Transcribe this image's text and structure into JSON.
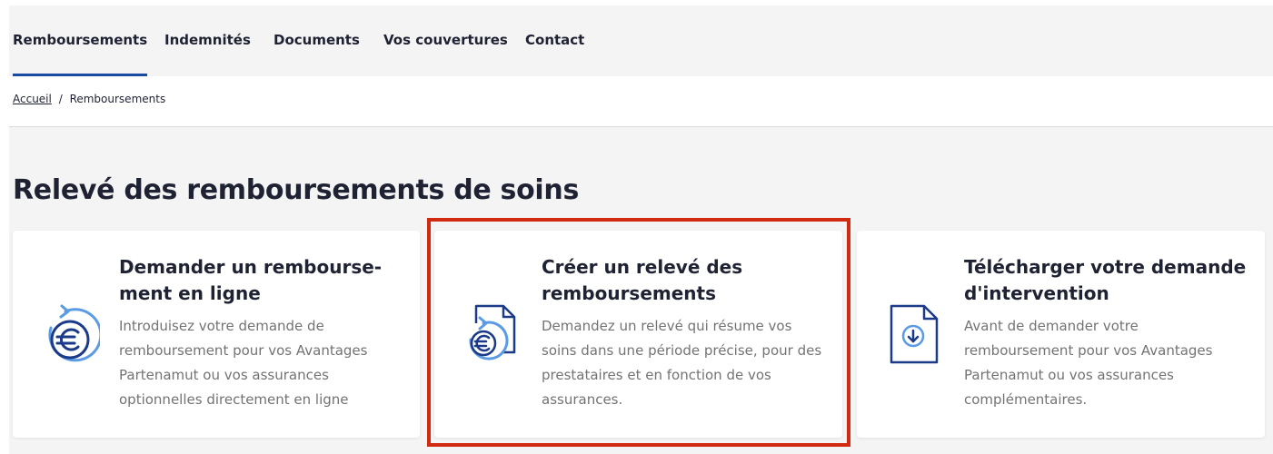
{
  "nav": {
    "items": [
      {
        "label": "Remboursements",
        "active": true
      },
      {
        "label": "Indemnités"
      },
      {
        "label": "Documents"
      },
      {
        "label": "Vos couvertures"
      },
      {
        "label": "Contact"
      }
    ]
  },
  "breadcrumb": {
    "home": "Accueil",
    "separator": "/",
    "current": "Remboursements"
  },
  "page": {
    "title": "Relevé des remboursements de soins"
  },
  "cards": [
    {
      "icon": "euro-refresh-icon",
      "title_line1": "Demander un rembourse-",
      "title_line2": "ment en ligne",
      "desc_lines": [
        "Introduisez votre demande de",
        "remboursement pour vos Avantages",
        "Partenamut ou vos assurances",
        "optionnelles directement en ligne"
      ]
    },
    {
      "icon": "euro-document-icon",
      "title_line1": "Créer un relevé des",
      "title_line2": "remboursements",
      "desc_lines": [
        "Demandez un relevé qui résume vos",
        "soins dans une période précise, pour des",
        "prestataires et en fonction de vos",
        "assurances."
      ],
      "highlighted": true
    },
    {
      "icon": "download-document-icon",
      "title_line1": "Télécharger votre demande",
      "title_line2": "d'intervention",
      "desc_lines": [
        "Avant de demander votre",
        "remboursement pour vos Avantages",
        "Partenamut ou vos assurances",
        "complémentaires."
      ]
    }
  ],
  "colors": {
    "accent": "#1b4ba0",
    "icon_dark": "#1b3a87",
    "icon_light": "#5b9be6",
    "highlight": "#d12a10",
    "text": "#1f2233",
    "muted": "#737373",
    "background": "#f4f4f4"
  }
}
